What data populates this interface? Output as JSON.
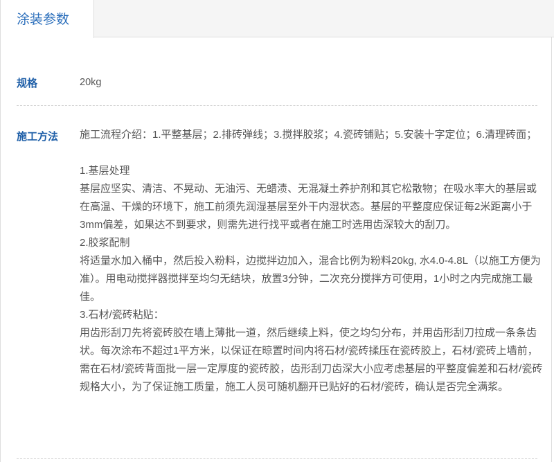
{
  "tabs": [
    {
      "label": "涂装参数",
      "active": true
    }
  ],
  "spec": {
    "label": "规格",
    "value": "20kg"
  },
  "method": {
    "label": "施工方法",
    "intro": "施工流程介绍：1.平整基层；2.排砖弹线；3.搅拌胶浆；4.瓷砖铺贴；5.安装十字定位；6.清理砖面；",
    "sections": [
      {
        "title": "1.基层处理",
        "body": "基层应坚实、清洁、不晃动、无油污、无蜡渍、无混凝土养护剂和其它松散物；在吸水率大的基层或在高温、干燥的环境下，施工前须先润湿基层至外干内湿状态。基层的平整度应保证每2米距离小于3mm偏差，如果达不到要求，则需先进行找平或者在施工时选用齿深较大的刮刀。"
      },
      {
        "title": "2.胶浆配制",
        "body": "将适量水加入桶中，然后投入粉料，边搅拌边加入，混合比例为粉料20kg, 水4.0-4.8L（以施工方便为准）。用电动搅拌器搅拌至均匀无结块，放置3分钟，二次充分搅拌方可使用，1小时之内完成施工最佳。"
      },
      {
        "title": "3.石材/瓷砖粘贴：",
        "body": "用齿形刮刀先将瓷砖胶在墙上薄批一道，然后继续上料，使之均匀分布，并用齿形刮刀拉成一条条齿状。每次涂布不超过1平方米，以保证在晾置时间内将石材/瓷砖揉压在瓷砖胶上，石材/瓷砖上墙前，需在石材/瓷砖背面批一层一定厚度的瓷砖胶，齿形刮刀齿深大小应考虑基层的平整度偏差和石材/瓷砖规格大小，为了保证施工质量，施工人员可随机翻开已贴好的石材/瓷砖，确认是否完全满浆。"
      }
    ]
  }
}
